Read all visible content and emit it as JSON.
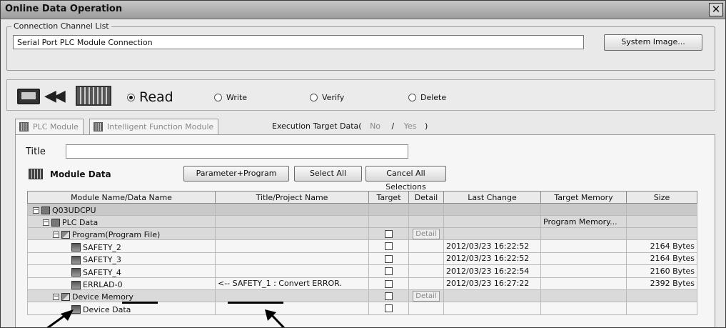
{
  "window": {
    "title": "Online Data Operation",
    "close_label": "✕"
  },
  "channel": {
    "legend": "Connection Channel List",
    "value": "Serial Port  PLC Module Connection",
    "system_image_label": "System Image..."
  },
  "operation": {
    "read": "Read",
    "write": "Write",
    "verify": "Verify",
    "delete": "Delete",
    "selected": "read"
  },
  "tabs": [
    {
      "label": "PLC Module"
    },
    {
      "label": "Intelligent Function Module"
    }
  ],
  "exec_target": {
    "prefix": "Execution Target Data(",
    "no": "No",
    "slash": "/",
    "yes": "Yes",
    "suffix": ")"
  },
  "title_field": {
    "label": "Title",
    "value": ""
  },
  "module_data": {
    "label": "Module Data",
    "param_prog_label": "Parameter+Program",
    "select_all_label": "Select All",
    "cancel_all_label": "Cancel All Selections"
  },
  "table": {
    "headers": [
      "Module Name/Data Name",
      "Title/Project Name",
      "Target",
      "Detail",
      "Last Change",
      "Target Memory",
      "Size"
    ],
    "rows": [
      {
        "name": "Q03UDCPU",
        "title": "",
        "target": false,
        "detail": "",
        "change": "",
        "memory": "",
        "size": "",
        "style": "grp",
        "indent": 0,
        "icon": "cpu-icon"
      },
      {
        "name": "PLC Data",
        "title": "",
        "target": false,
        "detail": "",
        "change": "",
        "memory": "Program Memory...",
        "size": "",
        "style": "sub",
        "indent": 1,
        "icon": "plc-data-icon"
      },
      {
        "name": "Program(Program File)",
        "title": "",
        "target": true,
        "detail": "Detail",
        "change": "",
        "memory": "",
        "size": "",
        "style": "sub",
        "indent": 2,
        "icon": "program-folder-icon"
      },
      {
        "name": "SAFETY_2",
        "title": "",
        "target": true,
        "detail": "",
        "change": "2012/03/23 16:22:52",
        "memory": "",
        "size": "2164 Bytes",
        "style": "",
        "indent": 3,
        "icon": "program-file-icon"
      },
      {
        "name": "SAFETY_3",
        "title": "",
        "target": true,
        "detail": "",
        "change": "2012/03/23 16:22:52",
        "memory": "",
        "size": "2164 Bytes",
        "style": "",
        "indent": 3,
        "icon": "program-file-icon"
      },
      {
        "name": "SAFETY_4",
        "title": "",
        "target": true,
        "detail": "",
        "change": "2012/03/23 16:22:54",
        "memory": "",
        "size": "2160 Bytes",
        "style": "",
        "indent": 3,
        "icon": "program-file-icon"
      },
      {
        "name": "ERRLAD-0",
        "title": "<-- SAFETY_1 : Convert ERROR.",
        "target": true,
        "detail": "",
        "change": "2012/03/23 16:27:22",
        "memory": "",
        "size": "2392 Bytes",
        "style": "",
        "indent": 3,
        "icon": "program-file-icon"
      },
      {
        "name": "Device Memory",
        "title": "",
        "target": true,
        "detail": "Detail",
        "change": "",
        "memory": "",
        "size": "",
        "style": "sub",
        "indent": 2,
        "icon": "device-memory-icon"
      },
      {
        "name": "Device Data",
        "title": "",
        "target": true,
        "detail": "",
        "change": "",
        "memory": "",
        "size": "",
        "style": "",
        "indent": 3,
        "icon": "device-data-icon"
      }
    ]
  }
}
